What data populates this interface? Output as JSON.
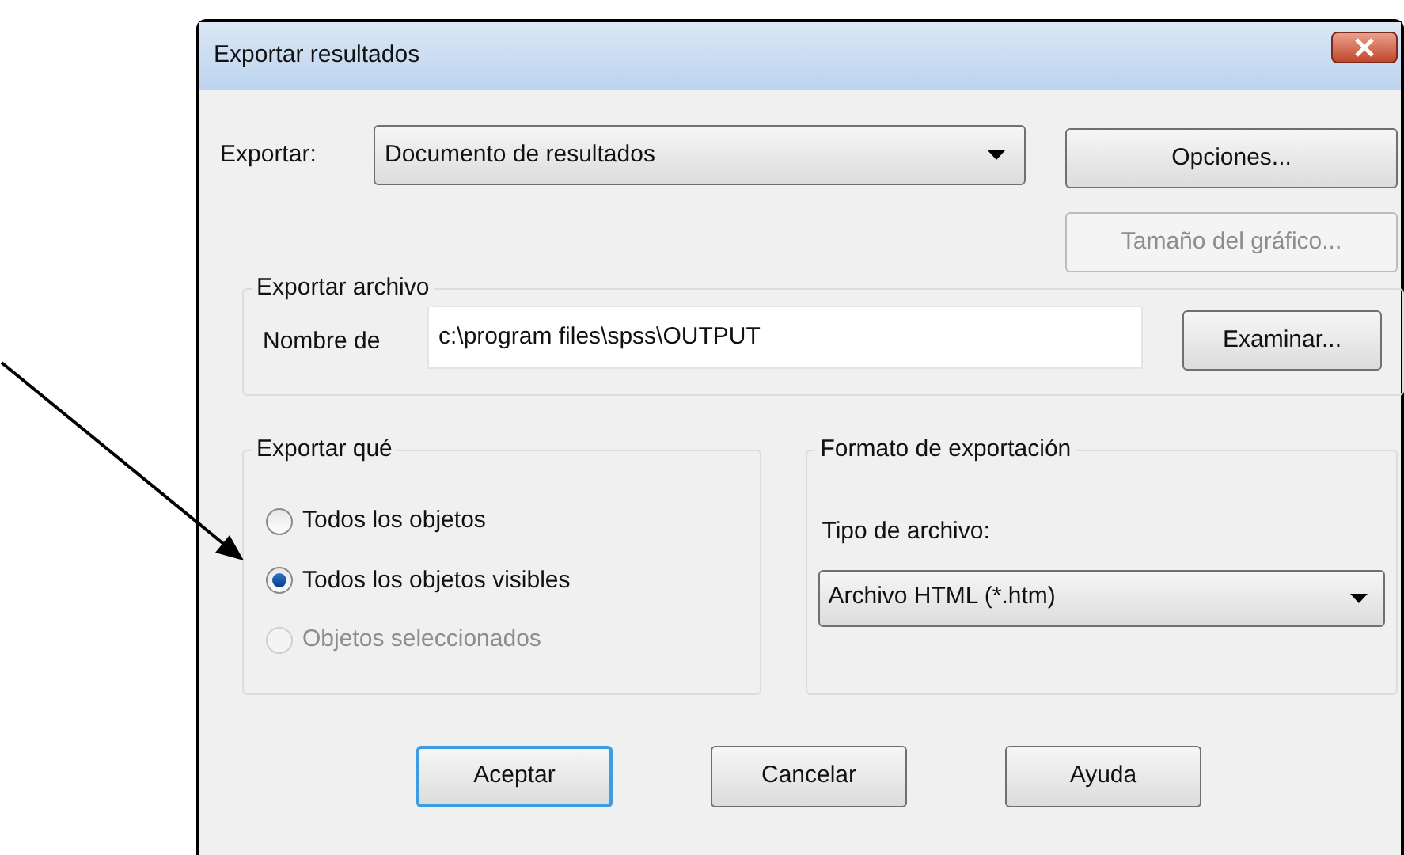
{
  "window": {
    "title": "Exportar resultados"
  },
  "export": {
    "label": "Exportar:",
    "value": "Documento de resultados"
  },
  "side_buttons": [
    {
      "label": "Opciones...",
      "disabled": false
    },
    {
      "label": "Tamaño del gráfico...",
      "disabled": true
    }
  ],
  "export_file": {
    "title": "Exportar archivo",
    "label": "Nombre de",
    "value": "c:\\program files\\spss\\OUTPUT",
    "browse": "Examinar..."
  },
  "export_what": {
    "title": "Exportar qué",
    "options": [
      {
        "label": "Todos los objetos",
        "selected": false,
        "disabled": false
      },
      {
        "label": "Todos los objetos visibles",
        "selected": true,
        "disabled": false
      },
      {
        "label": "Objetos seleccionados",
        "selected": false,
        "disabled": true
      }
    ]
  },
  "format": {
    "title": "Formato de exportación",
    "label": "Tipo de archivo:",
    "value": "Archivo HTML (*.htm)"
  },
  "buttons": [
    {
      "label": "Aceptar",
      "default": true
    },
    {
      "label": "Cancelar",
      "default": false
    },
    {
      "label": "Ayuda",
      "default": false
    }
  ]
}
